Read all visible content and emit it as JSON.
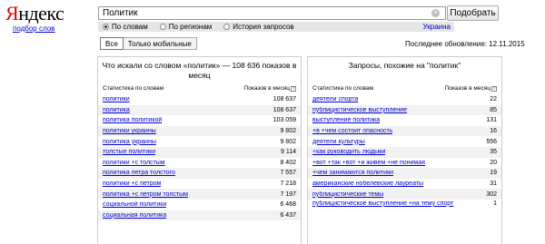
{
  "logo": {
    "first": "Я",
    "rest": "ндекс"
  },
  "subtitle": "подбор слов",
  "search": {
    "value": "Политик",
    "button": "Подобрать"
  },
  "modes": [
    {
      "label": "По словам",
      "selected": true
    },
    {
      "label": "По регионам",
      "selected": false
    },
    {
      "label": "История запросов",
      "selected": false
    }
  ],
  "region": "Украина",
  "device_tabs": [
    "Все",
    "Только мобильные"
  ],
  "last_update": "Последнее обновление: 12.11.2015",
  "left_panel": {
    "title": "Что искали со словом «политик» — 108 636 показов в месяц",
    "col_phrase": "Статистика по словам",
    "col_count": "Показов в месяц",
    "rows": [
      {
        "phrase": "политики",
        "count": "108 637"
      },
      {
        "phrase": "политика",
        "count": "108 637"
      },
      {
        "phrase": "политика политикой",
        "count": "103 059"
      },
      {
        "phrase": "политики украины",
        "count": "9 802"
      },
      {
        "phrase": "политика украины",
        "count": "9 802"
      },
      {
        "phrase": "толстые политики",
        "count": "9 114"
      },
      {
        "phrase": "политики +с толстым",
        "count": "8 402"
      },
      {
        "phrase": "политика петра толстого",
        "count": "7 557"
      },
      {
        "phrase": "политики +с петром",
        "count": "7 218"
      },
      {
        "phrase": "политика +с петром толстым",
        "count": "7 197"
      },
      {
        "phrase": "социальной политики",
        "count": "6 468"
      },
      {
        "phrase": "социальная политика",
        "count": "6 437"
      }
    ]
  },
  "right_panel": {
    "title": "Запросы, похожие на \"политик\"",
    "col_phrase": "Статистика по словам",
    "col_count": "Показов в месяц",
    "rows": [
      {
        "phrase": "деятели спорта",
        "count": "22"
      },
      {
        "phrase": "публицистическое выступление",
        "count": "85"
      },
      {
        "phrase": "выступление политика",
        "count": "131"
      },
      {
        "phrase": "+в +чем состоит опасность",
        "count": "16"
      },
      {
        "phrase": "деятели культуры",
        "count": "556"
      },
      {
        "phrase": "+как руководить людьми",
        "count": "35"
      },
      {
        "phrase": "+вот +так +вот +и живем +не понимая",
        "count": "20"
      },
      {
        "phrase": "+чем занимаются политики",
        "count": "19"
      },
      {
        "phrase": "американские нобелевские лауреаты",
        "count": "31"
      },
      {
        "phrase": "публицистические темы",
        "count": "302"
      },
      {
        "phrase": "публицистическое выступление +на тему спорт",
        "count": "1"
      }
    ]
  }
}
